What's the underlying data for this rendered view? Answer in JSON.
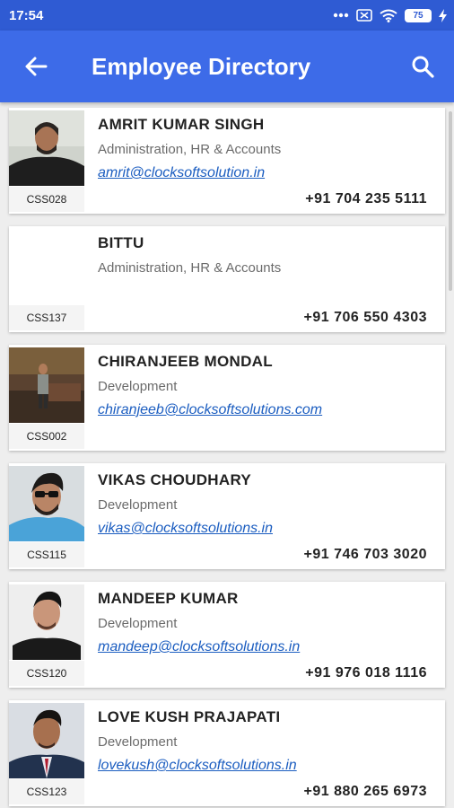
{
  "status": {
    "time": "17:54",
    "battery": "75"
  },
  "appbar": {
    "title": "Employee Directory"
  },
  "employees": [
    {
      "code": "CSS028",
      "name": "AMRIT KUMAR SINGH",
      "dept": "Administration, HR  &  Accounts",
      "email": "amrit@clocksoftsolution.in",
      "phone": "+91 704 235 5111"
    },
    {
      "code": "CSS137",
      "name": "BITTU",
      "dept": "Administration, HR  &  Accounts",
      "email": "",
      "phone": "+91 706 550 4303"
    },
    {
      "code": "CSS002",
      "name": "CHIRANJEEB  MONDAL",
      "dept": "Development",
      "email": "chiranjeeb@clocksoftsolutions.com",
      "phone": ""
    },
    {
      "code": "CSS115",
      "name": "VIKAS  CHOUDHARY",
      "dept": "Development",
      "email": "vikas@clocksoftsolutions.in",
      "phone": "+91 746 703 3020"
    },
    {
      "code": "CSS120",
      "name": "MANDEEP  KUMAR",
      "dept": "Development",
      "email": "mandeep@clocksoftsolutions.in",
      "phone": "+91 976 018 1116"
    },
    {
      "code": "CSS123",
      "name": "LOVE KUSH   PRAJAPATI",
      "dept": "Development",
      "email": "lovekush@clocksoftsolutions.in",
      "phone": "+91 880 265 6973"
    }
  ]
}
